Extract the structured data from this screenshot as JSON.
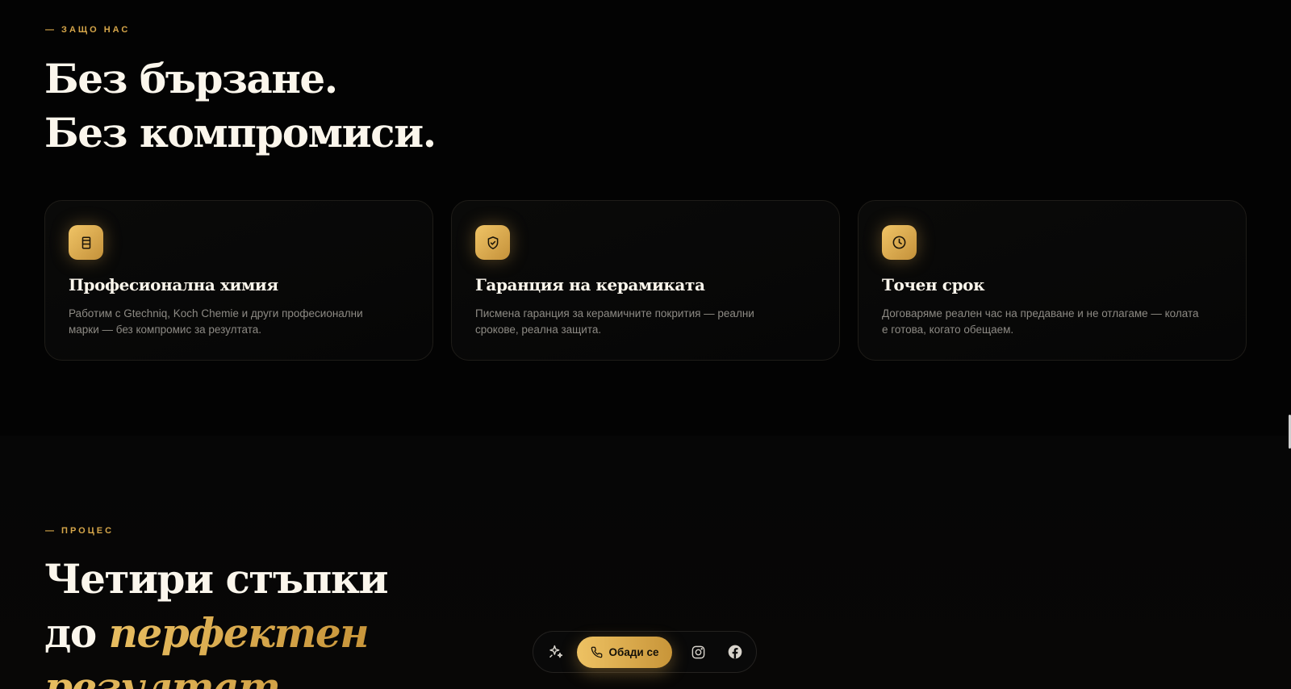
{
  "why": {
    "eyebrow": "— ЗАЩО НАС",
    "headline_line1": "Без бързане.",
    "headline_line2": "Без компромиси.",
    "cards": [
      {
        "icon": "jar-icon",
        "title": "Професионална химия",
        "description": "Работим с Gtechniq, Koch Chemie и други професионални марки — без компромис за резултата."
      },
      {
        "icon": "shield-check-icon",
        "title": "Гаранция на керамиката",
        "description": "Писмена гаранция за керамичните покрития — реални срокове, реална защита."
      },
      {
        "icon": "clock-icon",
        "title": "Точен срок",
        "description": "Договаряме реален час на предаване и не отлагаме — колата е готова, когато обещаем."
      }
    ]
  },
  "process": {
    "eyebrow": "— ПРОЦЕС",
    "headline_line1": "Четири стъпки",
    "headline_line2_plain": "до ",
    "headline_line2_accent": "перфектен",
    "headline_line3_accent": "резултат."
  },
  "dock": {
    "sparkle_icon": "sparkle-icon",
    "call_label": "Обади се",
    "call_icon": "phone-icon",
    "instagram_icon": "instagram-icon",
    "facebook_icon": "facebook-icon"
  },
  "colors": {
    "background": "#030303",
    "accent_gold": "#e0b458",
    "text_primary": "#fbf6ec",
    "text_muted": "#8d8a84"
  }
}
